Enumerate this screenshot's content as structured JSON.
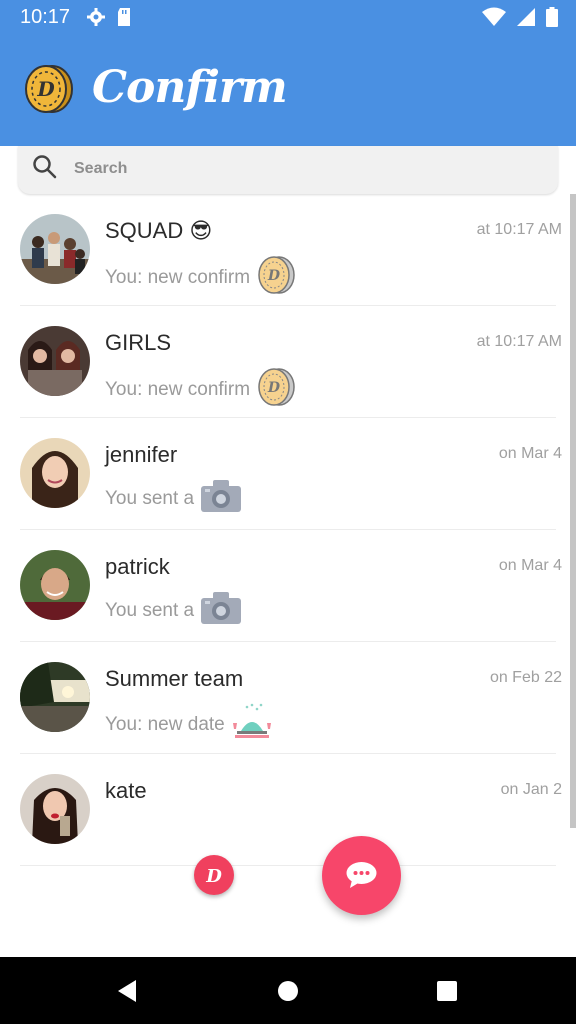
{
  "status_bar": {
    "time": "10:17",
    "icons": [
      "gear-icon",
      "sd-card-icon",
      "wifi-icon",
      "signal-icon",
      "battery-icon"
    ]
  },
  "app_bar": {
    "title": "Confirm",
    "logo_icon": "coin-logo-icon",
    "background_color": "#4a90e2"
  },
  "search": {
    "placeholder": "Search",
    "value": ""
  },
  "chats": [
    {
      "name": "SQUAD 😎",
      "time": "at 10:17 AM",
      "preview": "You: new confirm",
      "preview_icon": "coin-icon",
      "avatar": "group-photo"
    },
    {
      "name": "GIRLS",
      "time": "at 10:17 AM",
      "preview": "You: new confirm",
      "preview_icon": "coin-icon",
      "avatar": "group-photo"
    },
    {
      "name": "jennifer",
      "time": "on Mar 4",
      "preview": "You sent a",
      "preview_icon": "camera-icon",
      "avatar": "person-photo"
    },
    {
      "name": "patrick",
      "time": "on Mar 4",
      "preview": "You sent a",
      "preview_icon": "camera-icon",
      "avatar": "person-photo"
    },
    {
      "name": "Summer team",
      "time": "on Feb 22",
      "preview": "You: new date",
      "preview_icon": "dinner-icon",
      "avatar": "landscape-photo"
    },
    {
      "name": "kate",
      "time": "on Jan 2",
      "preview": "",
      "preview_icon": "",
      "avatar": "person-photo"
    }
  ],
  "fabs": {
    "small_icon": "d-logo-icon",
    "big_icon": "chat-bubble-icon",
    "accent_color": "#f7466a"
  },
  "nav_bar": {
    "icons": [
      "back-icon",
      "home-icon",
      "recents-icon"
    ]
  }
}
